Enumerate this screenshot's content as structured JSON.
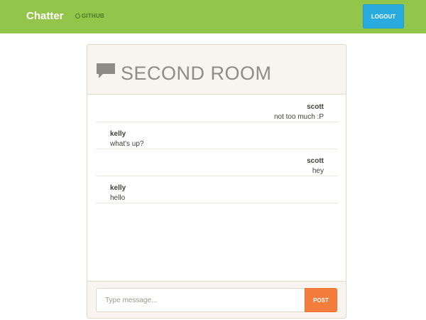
{
  "navbar": {
    "brand": "Chatter",
    "github_label": "GITHUB",
    "github_icon": "github-icon",
    "logout_label": "LOGOUT"
  },
  "room": {
    "title": "SECOND ROOM",
    "icon": "chat-bubble-icon"
  },
  "messages": [
    {
      "author": "scott",
      "text": "not too much :P",
      "side": "right"
    },
    {
      "author": "kelly",
      "text": "what's up?",
      "side": "left"
    },
    {
      "author": "scott",
      "text": "hey",
      "side": "right"
    },
    {
      "author": "kelly",
      "text": "hello",
      "side": "left"
    }
  ],
  "composer": {
    "placeholder": "Type message...",
    "value": "",
    "post_label": "POST"
  },
  "colors": {
    "navbar": "#93c54b",
    "logout": "#29abe0",
    "post": "#f47c3c",
    "panel_bg": "#f8f5f0",
    "title": "#8e8c84"
  }
}
